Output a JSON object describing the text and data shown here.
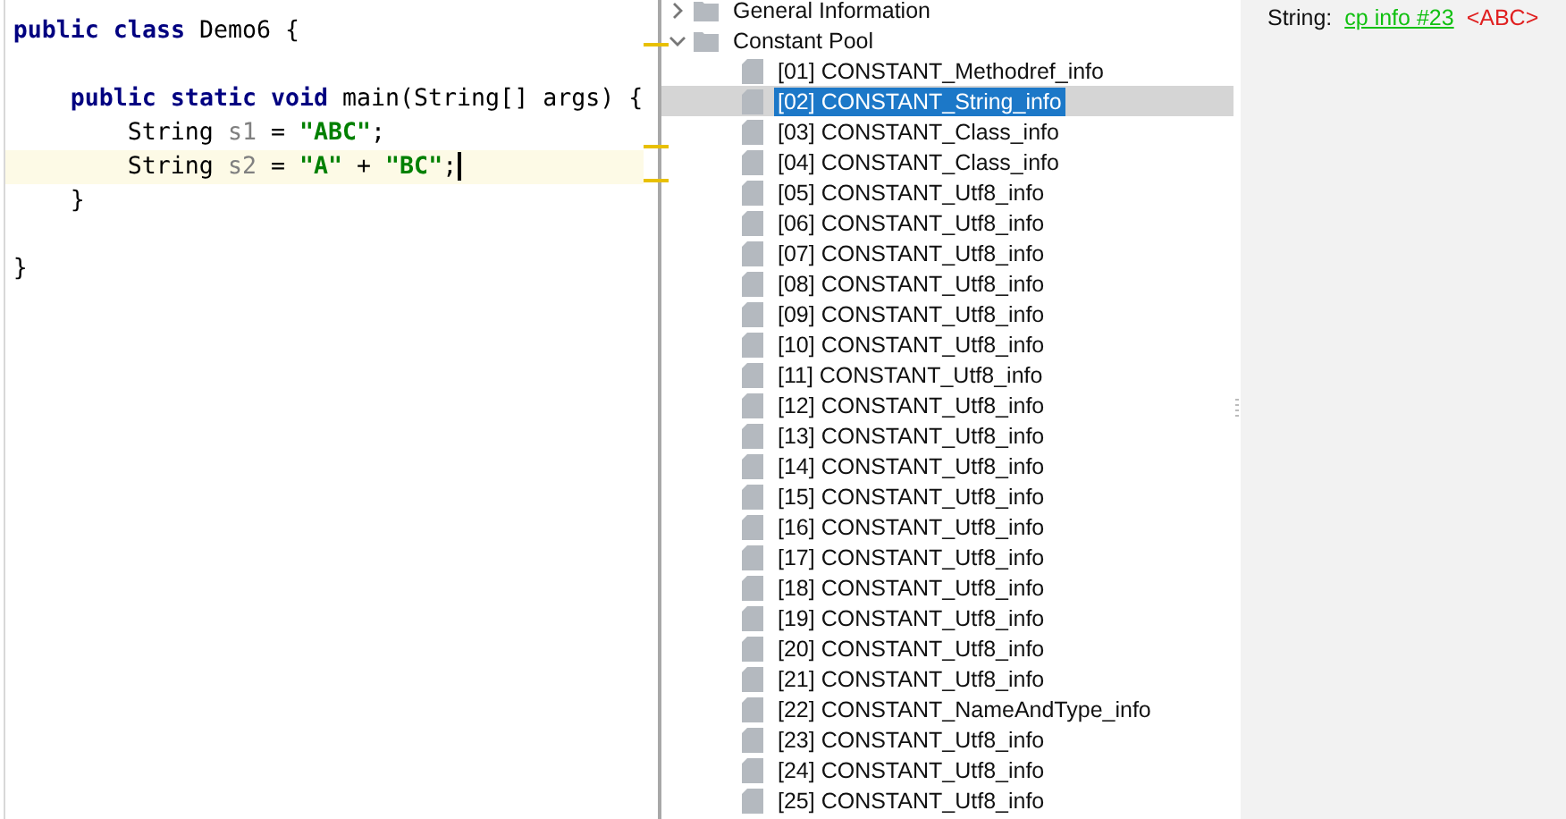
{
  "editor": {
    "lines": [
      {
        "current": false,
        "kind": "class",
        "tokens": [
          {
            "kind": "keyword",
            "text": "public class "
          },
          {
            "kind": "plain",
            "text": "Demo6 {"
          }
        ]
      },
      {
        "current": false,
        "kind": "blank"
      },
      {
        "current": false,
        "kind": "member",
        "tokens": [
          {
            "kind": "keyword",
            "text": "public static void "
          },
          {
            "kind": "plain",
            "text": "main(String[] args) {"
          }
        ]
      },
      {
        "current": false,
        "kind": "statement",
        "tokens": [
          {
            "kind": "plain",
            "text": "String "
          },
          {
            "kind": "variable",
            "text": "s1"
          },
          {
            "kind": "plain",
            "text": " = "
          },
          {
            "kind": "string",
            "text": "\"ABC\""
          },
          {
            "kind": "plain",
            "text": ";"
          }
        ]
      },
      {
        "current": true,
        "kind": "statement",
        "tokens": [
          {
            "kind": "plain",
            "text": "String "
          },
          {
            "kind": "variable",
            "text": "s2"
          },
          {
            "kind": "plain",
            "text": " = "
          },
          {
            "kind": "string",
            "text": "\"A\""
          },
          {
            "kind": "plain",
            "text": " + "
          },
          {
            "kind": "string",
            "text": "\"BC\""
          },
          {
            "kind": "plain",
            "text": ";"
          }
        ]
      },
      {
        "current": false,
        "kind": "member",
        "tokens": [
          {
            "kind": "plain",
            "text": "}"
          }
        ]
      },
      {
        "current": false,
        "kind": "blank"
      },
      {
        "current": false,
        "kind": "class",
        "tokens": [
          {
            "kind": "plain",
            "text": "}"
          }
        ]
      }
    ]
  },
  "tree": {
    "nodes": [
      {
        "label": "General Information",
        "kind": "folder",
        "expanded": false
      },
      {
        "label": "Constant Pool",
        "kind": "folder",
        "expanded": true,
        "children": [
          {
            "label": "[01] CONSTANT_Methodref_info",
            "selected": false
          },
          {
            "label": "[02] CONSTANT_String_info",
            "selected": true
          },
          {
            "label": "[03] CONSTANT_Class_info",
            "selected": false
          },
          {
            "label": "[04] CONSTANT_Class_info",
            "selected": false
          },
          {
            "label": "[05] CONSTANT_Utf8_info",
            "selected": false
          },
          {
            "label": "[06] CONSTANT_Utf8_info",
            "selected": false
          },
          {
            "label": "[07] CONSTANT_Utf8_info",
            "selected": false
          },
          {
            "label": "[08] CONSTANT_Utf8_info",
            "selected": false
          },
          {
            "label": "[09] CONSTANT_Utf8_info",
            "selected": false
          },
          {
            "label": "[10] CONSTANT_Utf8_info",
            "selected": false
          },
          {
            "label": "[11] CONSTANT_Utf8_info",
            "selected": false
          },
          {
            "label": "[12] CONSTANT_Utf8_info",
            "selected": false
          },
          {
            "label": "[13] CONSTANT_Utf8_info",
            "selected": false
          },
          {
            "label": "[14] CONSTANT_Utf8_info",
            "selected": false
          },
          {
            "label": "[15] CONSTANT_Utf8_info",
            "selected": false
          },
          {
            "label": "[16] CONSTANT_Utf8_info",
            "selected": false
          },
          {
            "label": "[17] CONSTANT_Utf8_info",
            "selected": false
          },
          {
            "label": "[18] CONSTANT_Utf8_info",
            "selected": false
          },
          {
            "label": "[19] CONSTANT_Utf8_info",
            "selected": false
          },
          {
            "label": "[20] CONSTANT_Utf8_info",
            "selected": false
          },
          {
            "label": "[21] CONSTANT_Utf8_info",
            "selected": false
          },
          {
            "label": "[22] CONSTANT_NameAndType_info",
            "selected": false
          },
          {
            "label": "[23] CONSTANT_Utf8_info",
            "selected": false
          },
          {
            "label": "[24] CONSTANT_Utf8_info",
            "selected": false
          },
          {
            "label": "[25] CONSTANT_Utf8_info",
            "selected": false
          }
        ]
      }
    ]
  },
  "details": {
    "label": "String:",
    "link": "cp info #23",
    "value": "<ABC>"
  }
}
